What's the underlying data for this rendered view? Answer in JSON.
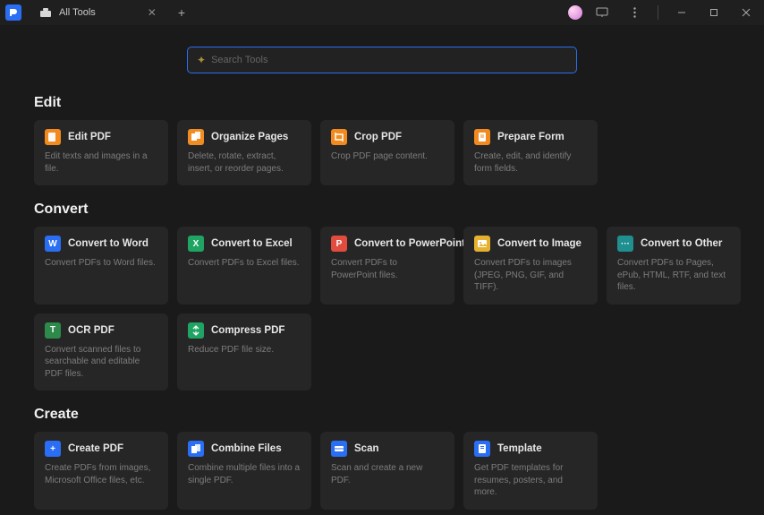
{
  "titlebar": {
    "tab_label": "All Tools"
  },
  "search": {
    "placeholder": "Search Tools"
  },
  "sections": {
    "edit": {
      "title": "Edit",
      "cards": [
        {
          "title": "Edit PDF",
          "desc": "Edit texts and images in a file."
        },
        {
          "title": "Organize Pages",
          "desc": "Delete, rotate, extract, insert, or reorder pages."
        },
        {
          "title": "Crop PDF",
          "desc": "Crop PDF page content."
        },
        {
          "title": "Prepare Form",
          "desc": "Create, edit, and identify form fields."
        }
      ]
    },
    "convert": {
      "title": "Convert",
      "cards": [
        {
          "title": "Convert to Word",
          "desc": "Convert PDFs to Word files."
        },
        {
          "title": "Convert to Excel",
          "desc": "Convert PDFs to Excel files."
        },
        {
          "title": "Convert to PowerPoint",
          "desc": "Convert PDFs to PowerPoint files."
        },
        {
          "title": "Convert to Image",
          "desc": "Convert PDFs to images (JPEG, PNG, GIF, and TIFF)."
        },
        {
          "title": "Convert to Other",
          "desc": "Convert PDFs to Pages, ePub, HTML, RTF, and text files."
        },
        {
          "title": "OCR PDF",
          "desc": "Convert scanned files to searchable and editable PDF files."
        },
        {
          "title": "Compress PDF",
          "desc": "Reduce PDF file size."
        }
      ]
    },
    "create": {
      "title": "Create",
      "cards": [
        {
          "title": "Create PDF",
          "desc": "Create PDFs from images, Microsoft Office files, etc."
        },
        {
          "title": "Combine Files",
          "desc": "Combine multiple files into a single PDF."
        },
        {
          "title": "Scan",
          "desc": "Scan and create a new PDF."
        },
        {
          "title": "Template",
          "desc": "Get PDF templates for resumes, posters, and more."
        }
      ]
    }
  }
}
